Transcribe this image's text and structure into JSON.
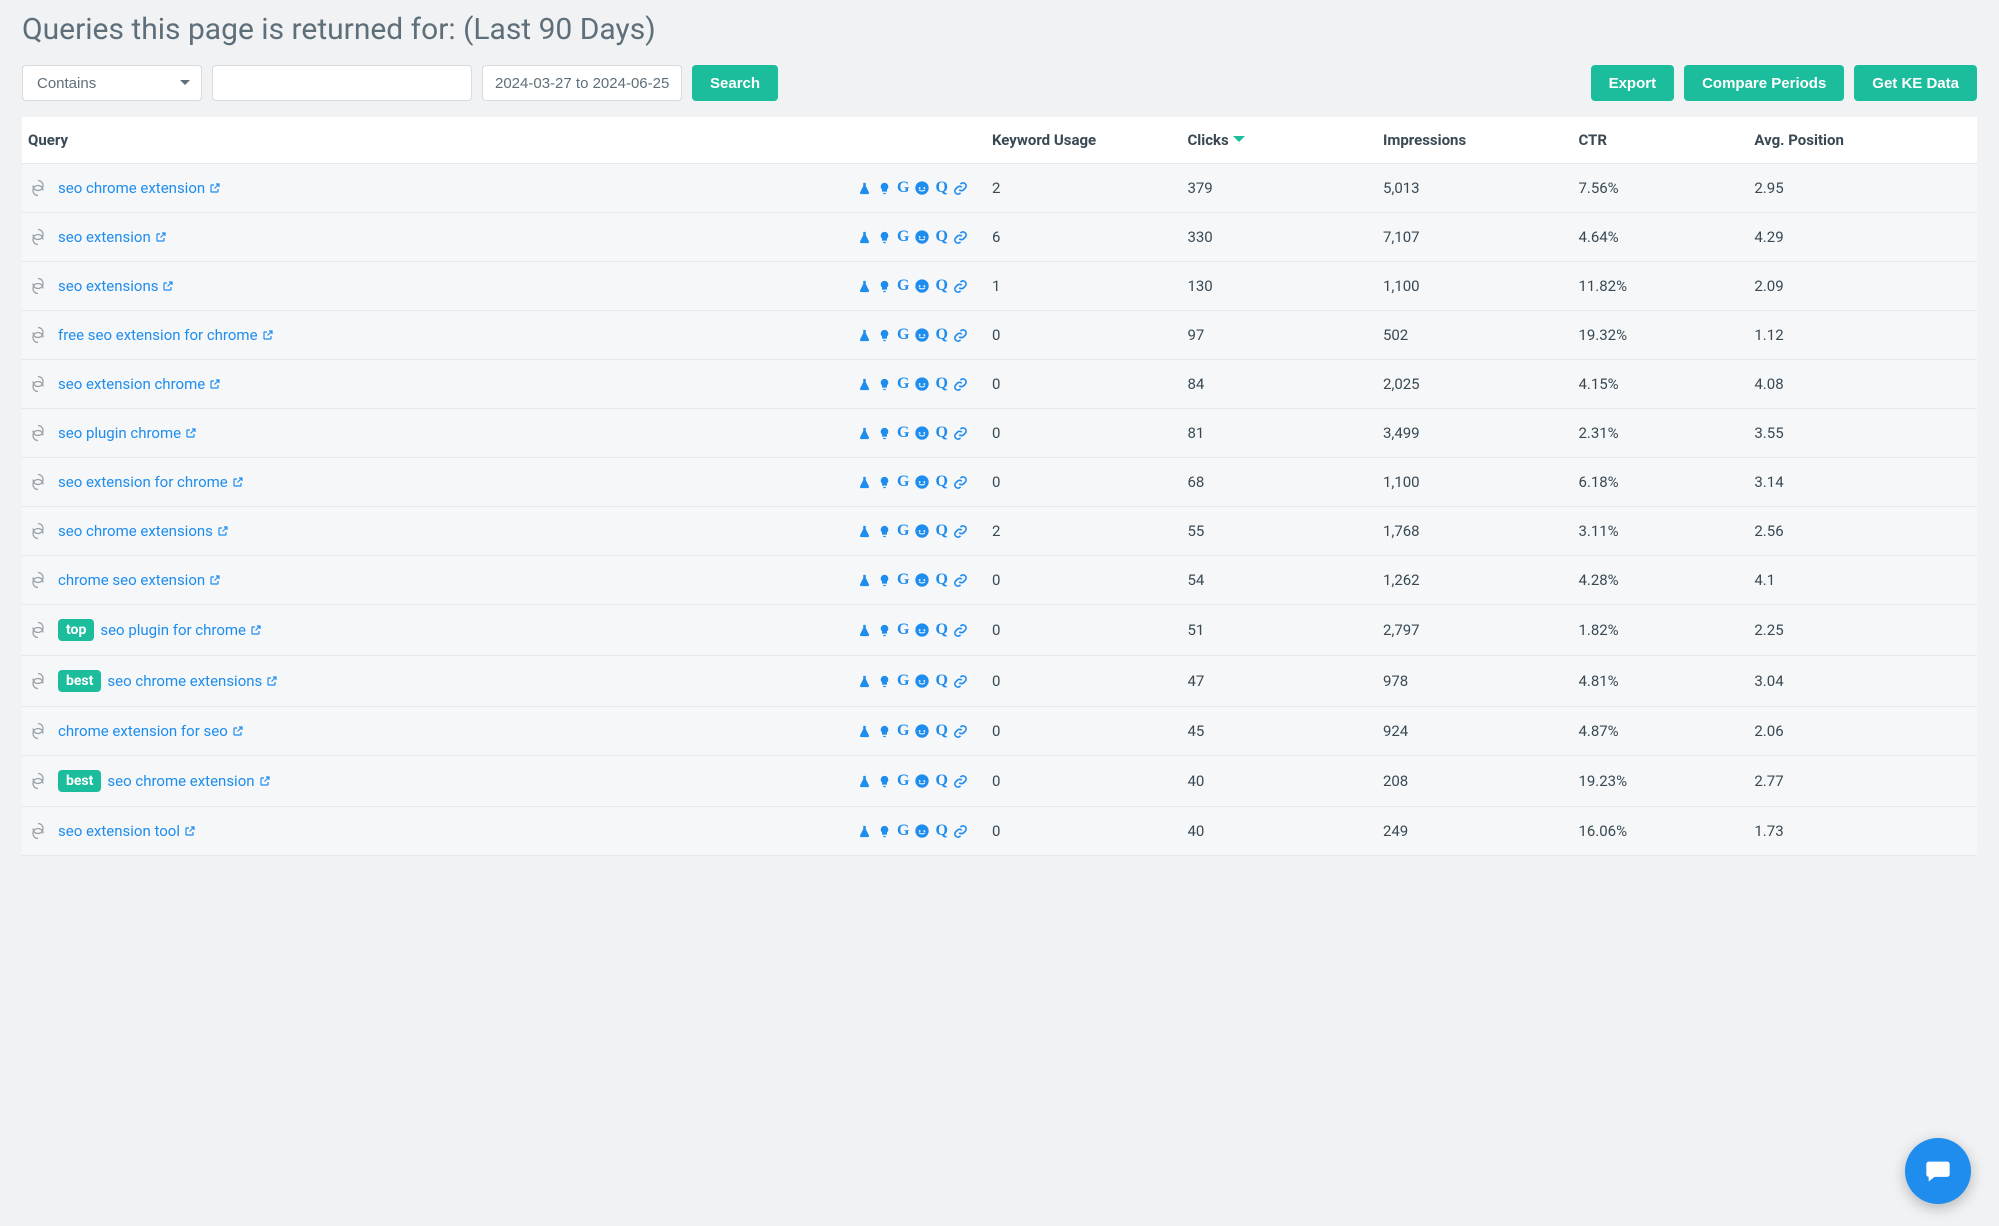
{
  "title": "Queries this page is returned for: (Last 90 Days)",
  "toolbar": {
    "contains_label": "Contains",
    "filter_value": "",
    "date_range": "2024-03-27 to 2024-06-25",
    "search_label": "Search",
    "export_label": "Export",
    "compare_label": "Compare Periods",
    "ke_label": "Get KE Data"
  },
  "columns": {
    "query": "Query",
    "keyword_usage": "Keyword Usage",
    "clicks": "Clicks",
    "impressions": "Impressions",
    "ctr": "CTR",
    "avg_position": "Avg. Position"
  },
  "sorted_by": "clicks",
  "sort_dir": "desc",
  "tool_icons": [
    "flask",
    "bulb",
    "google",
    "reddit",
    "quora",
    "link"
  ],
  "rows": [
    {
      "badge": null,
      "query": "seo chrome extension",
      "keyword_usage": "2",
      "clicks": "379",
      "impressions": "5,013",
      "ctr": "7.56%",
      "avg_position": "2.95"
    },
    {
      "badge": null,
      "query": "seo extension",
      "keyword_usage": "6",
      "clicks": "330",
      "impressions": "7,107",
      "ctr": "4.64%",
      "avg_position": "4.29"
    },
    {
      "badge": null,
      "query": "seo extensions",
      "keyword_usage": "1",
      "clicks": "130",
      "impressions": "1,100",
      "ctr": "11.82%",
      "avg_position": "2.09"
    },
    {
      "badge": null,
      "query": "free seo extension for chrome",
      "keyword_usage": "0",
      "clicks": "97",
      "impressions": "502",
      "ctr": "19.32%",
      "avg_position": "1.12"
    },
    {
      "badge": null,
      "query": "seo extension chrome",
      "keyword_usage": "0",
      "clicks": "84",
      "impressions": "2,025",
      "ctr": "4.15%",
      "avg_position": "4.08"
    },
    {
      "badge": null,
      "query": "seo plugin chrome",
      "keyword_usage": "0",
      "clicks": "81",
      "impressions": "3,499",
      "ctr": "2.31%",
      "avg_position": "3.55"
    },
    {
      "badge": null,
      "query": "seo extension for chrome",
      "keyword_usage": "0",
      "clicks": "68",
      "impressions": "1,100",
      "ctr": "6.18%",
      "avg_position": "3.14"
    },
    {
      "badge": null,
      "query": "seo chrome extensions",
      "keyword_usage": "2",
      "clicks": "55",
      "impressions": "1,768",
      "ctr": "3.11%",
      "avg_position": "2.56"
    },
    {
      "badge": null,
      "query": "chrome seo extension",
      "keyword_usage": "0",
      "clicks": "54",
      "impressions": "1,262",
      "ctr": "4.28%",
      "avg_position": "4.1"
    },
    {
      "badge": "top",
      "query": "seo plugin for chrome",
      "keyword_usage": "0",
      "clicks": "51",
      "impressions": "2,797",
      "ctr": "1.82%",
      "avg_position": "2.25"
    },
    {
      "badge": "best",
      "query": "seo chrome extensions",
      "keyword_usage": "0",
      "clicks": "47",
      "impressions": "978",
      "ctr": "4.81%",
      "avg_position": "3.04"
    },
    {
      "badge": null,
      "query": "chrome extension for seo",
      "keyword_usage": "0",
      "clicks": "45",
      "impressions": "924",
      "ctr": "4.87%",
      "avg_position": "2.06"
    },
    {
      "badge": "best",
      "query": "seo chrome extension",
      "keyword_usage": "0",
      "clicks": "40",
      "impressions": "208",
      "ctr": "19.23%",
      "avg_position": "2.77"
    },
    {
      "badge": null,
      "query": "seo extension tool",
      "keyword_usage": "0",
      "clicks": "40",
      "impressions": "249",
      "ctr": "16.06%",
      "avg_position": "1.73"
    }
  ]
}
